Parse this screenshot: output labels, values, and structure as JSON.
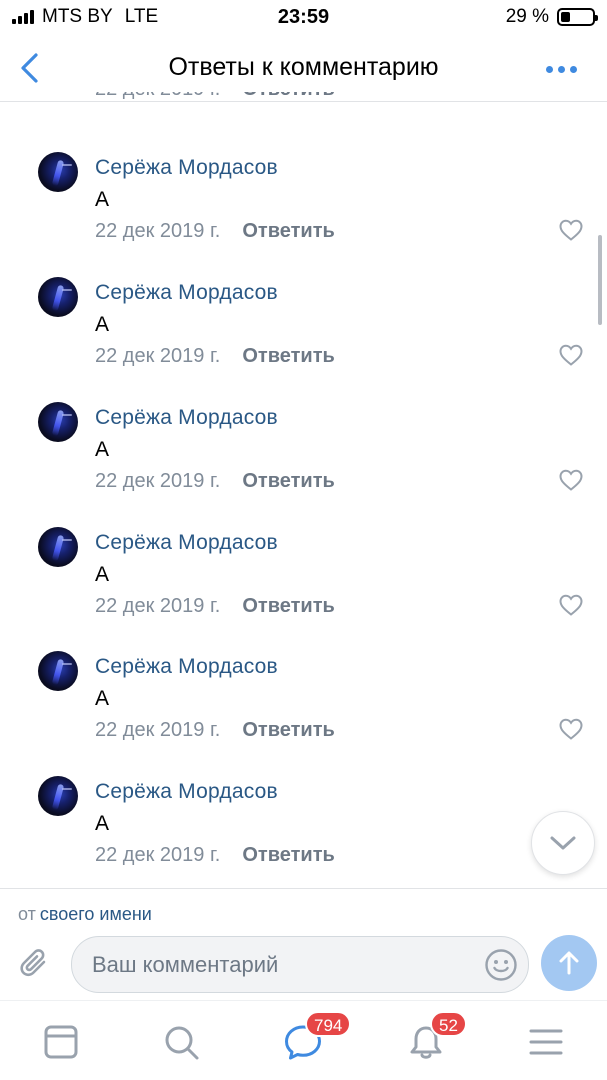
{
  "status_bar": {
    "carrier": "MTS BY",
    "network": "LTE",
    "time": "23:59",
    "battery": "29 %",
    "battery_level": 0.29
  },
  "header": {
    "title": "Ответы к комментарию",
    "back_icon": "chevron-left-icon",
    "more_icon": "more-horizontal-icon"
  },
  "partial_comment": {
    "date": "22 дек 2019 г.",
    "reply_label": "Ответить"
  },
  "comments": [
    {
      "author": "Серёжа Мордасов",
      "text": "А",
      "date": "22 дек 2019 г.",
      "reply_label": "Ответить"
    },
    {
      "author": "Серёжа Мордасов",
      "text": "А",
      "date": "22 дек 2019 г.",
      "reply_label": "Ответить"
    },
    {
      "author": "Серёжа Мордасов",
      "text": "А",
      "date": "22 дек 2019 г.",
      "reply_label": "Ответить"
    },
    {
      "author": "Серёжа Мордасов",
      "text": "А",
      "date": "22 дек 2019 г.",
      "reply_label": "Ответить"
    },
    {
      "author": "Серёжа Мордасов",
      "text": "А",
      "date": "22 дек 2019 г.",
      "reply_label": "Ответить"
    },
    {
      "author": "Серёжа Мордасов",
      "text": "А",
      "date": "22 дек 2019 г.",
      "reply_label": "Ответить"
    }
  ],
  "composer": {
    "from_prefix": "от",
    "from_link": "своего имени",
    "placeholder": "Ваш комментарий"
  },
  "tabbar": {
    "tabs": [
      {
        "icon": "news-icon"
      },
      {
        "icon": "search-icon"
      },
      {
        "icon": "messages-icon",
        "badge": "794"
      },
      {
        "icon": "notifications-icon",
        "badge": "52"
      },
      {
        "icon": "menu-icon"
      }
    ]
  },
  "colors": {
    "accent": "#3f8ae0",
    "author": "#2a5885",
    "secondary_text": "#818c99",
    "badge": "#e64646",
    "send_button": "#a3c8f2"
  }
}
